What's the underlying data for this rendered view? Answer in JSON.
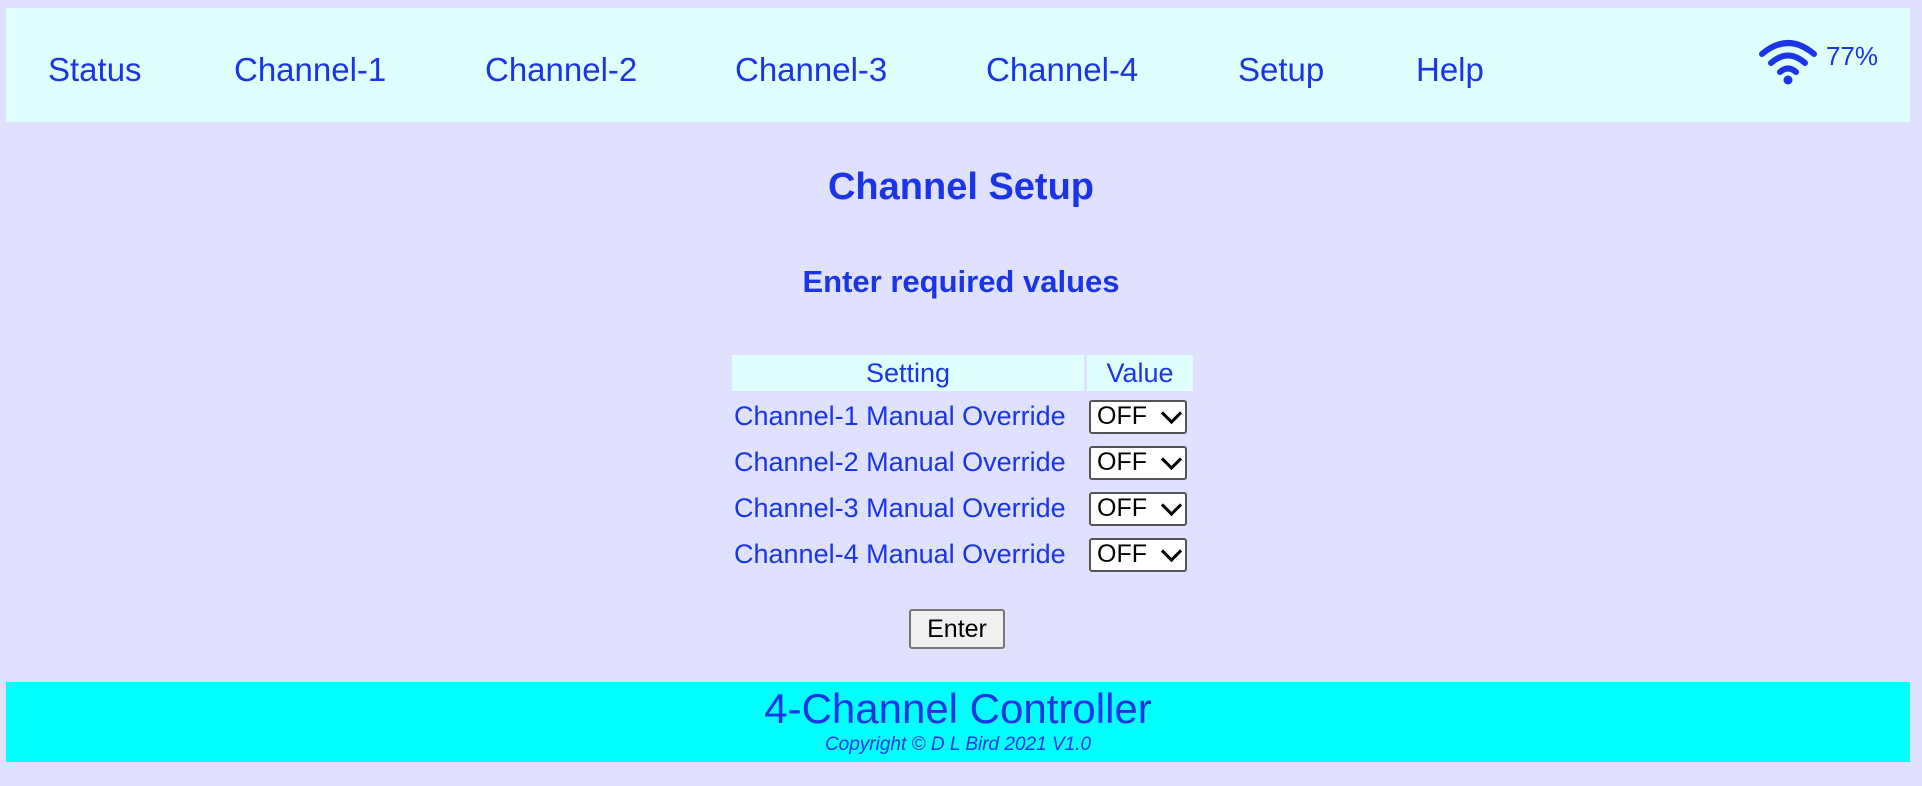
{
  "nav": {
    "items": [
      {
        "label": "Status"
      },
      {
        "label": "Channel-1"
      },
      {
        "label": "Channel-2"
      },
      {
        "label": "Channel-3"
      },
      {
        "label": "Channel-4"
      },
      {
        "label": "Setup"
      },
      {
        "label": "Help"
      }
    ],
    "wifi_icon": "wifi-icon",
    "signal_strength": "77%"
  },
  "page": {
    "title": "Channel Setup",
    "subtitle": "Enter required values"
  },
  "settings_table": {
    "headers": [
      "Setting",
      "Value"
    ],
    "rows": [
      {
        "setting": "Channel-1 Manual Override",
        "value": "OFF"
      },
      {
        "setting": "Channel-2 Manual Override",
        "value": "OFF"
      },
      {
        "setting": "Channel-3 Manual Override",
        "value": "OFF"
      },
      {
        "setting": "Channel-4 Manual Override",
        "value": "OFF"
      }
    ]
  },
  "enter_label": "Enter",
  "footer": {
    "title": "4-Channel Controller",
    "copyright": "Copyright © D L Bird 2021 V1.0"
  },
  "colors": {
    "text": "#1a35e8",
    "background": "#e0e0ff",
    "nav_background": "#e0ffff",
    "footer_background": "#00ffff"
  }
}
